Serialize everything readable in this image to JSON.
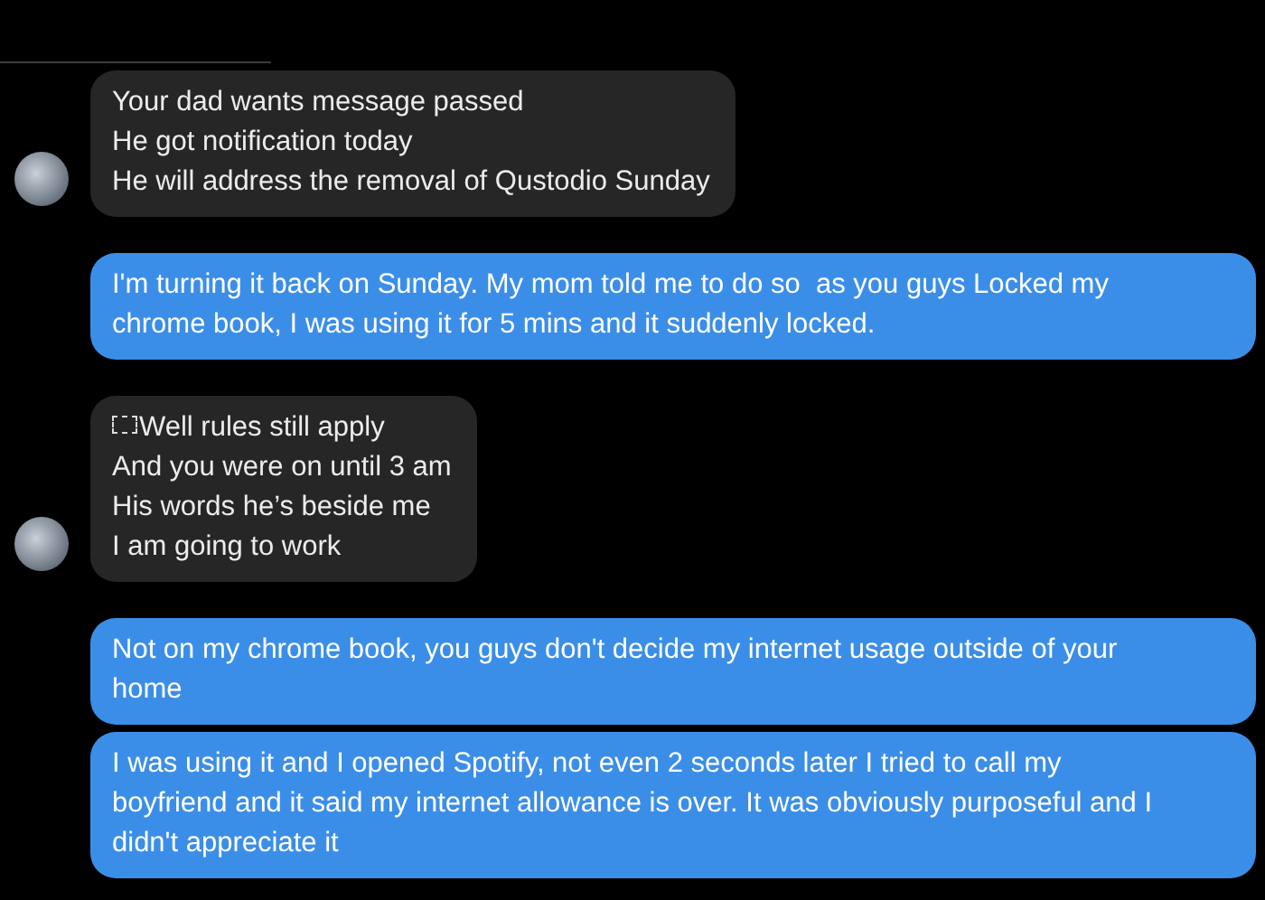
{
  "messages": [
    {
      "kind": "incoming",
      "avatar": true,
      "icon": false,
      "text": "Your dad wants message passed\nHe got notification today\nHe will address the removal of Qustodio Sunday"
    },
    {
      "kind": "outgoing",
      "avatar": false,
      "icon": false,
      "text": "I'm turning it back on Sunday. My mom told me to do so  as you guys Locked my chrome book, I was using it for 5 mins and it suddenly locked."
    },
    {
      "kind": "incoming",
      "avatar": true,
      "icon": true,
      "text": "Well rules still apply\nAnd you were on until 3 am\nHis words he’s beside me\nI am going to work"
    },
    {
      "kind": "outgoing",
      "avatar": false,
      "icon": false,
      "text": "Not on my chrome book, you guys don't decide my internet usage outside of your home"
    },
    {
      "kind": "outgoing",
      "avatar": false,
      "icon": false,
      "text": "I was using it and I opened Spotify, not even 2 seconds later I tried to call my boyfriend and it said my internet allowance is over. It was obviously purposeful and I didn't appreciate it"
    }
  ]
}
